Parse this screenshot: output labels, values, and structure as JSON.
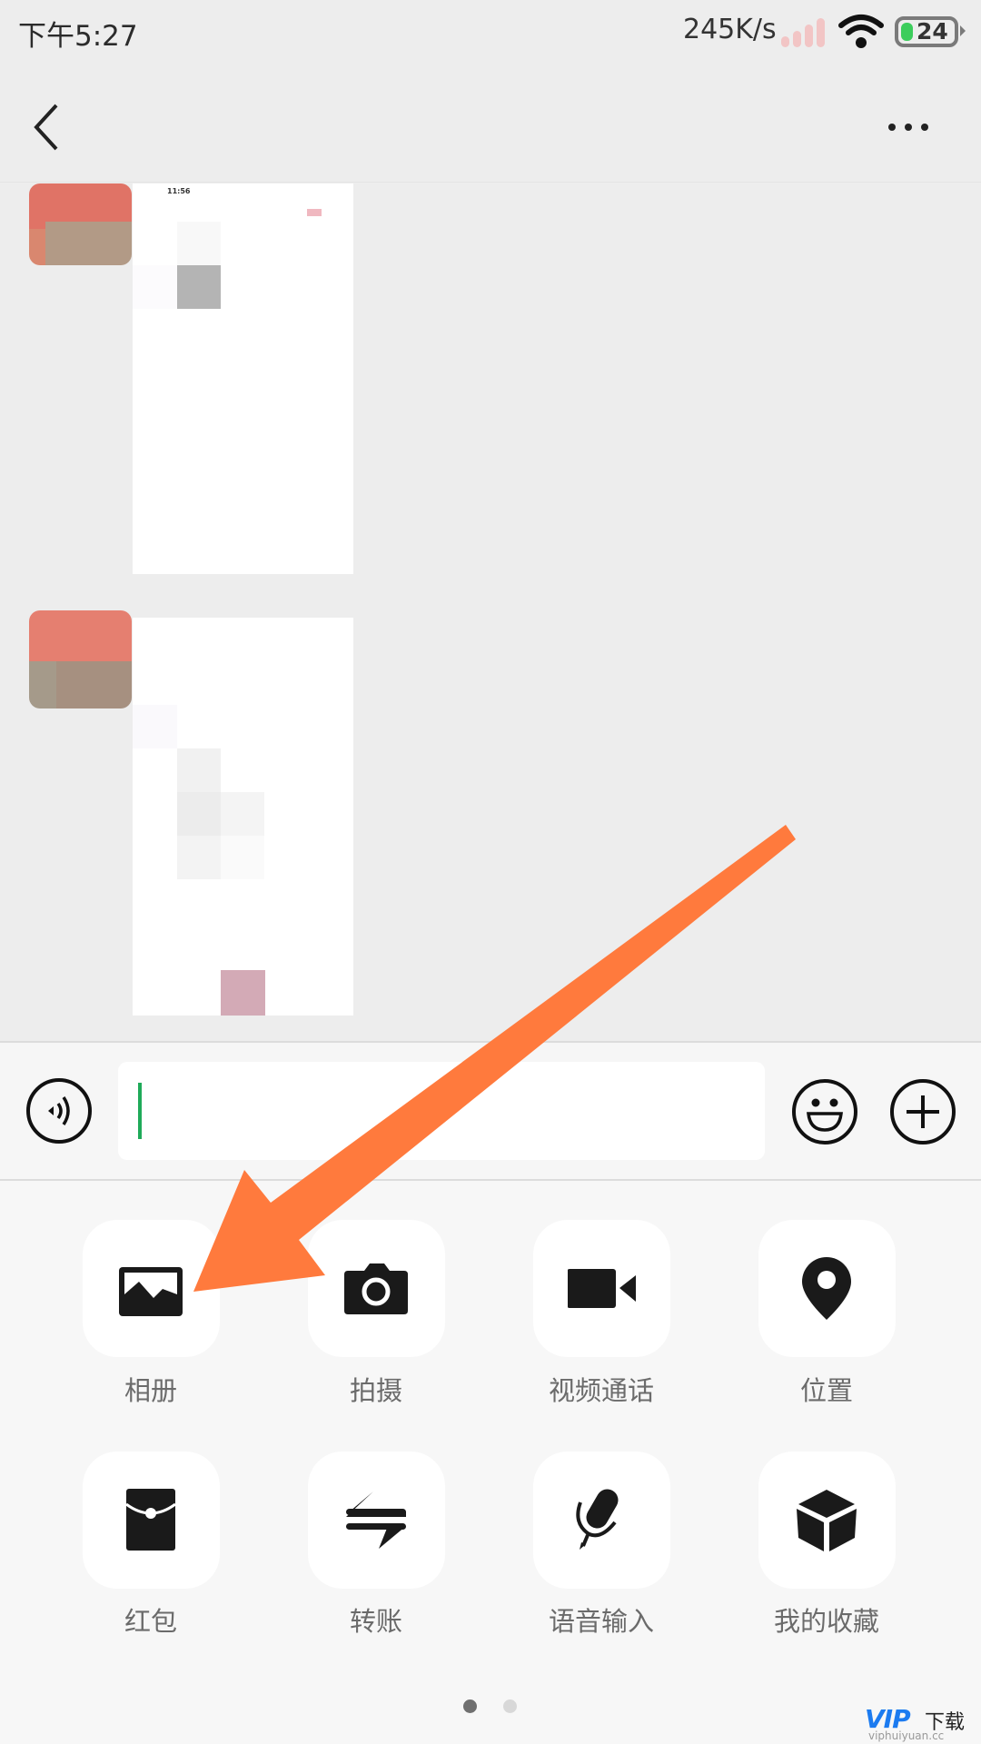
{
  "status_bar": {
    "time": "下午5:27",
    "network_speed": "245K/s",
    "battery_level": "24",
    "icons": [
      "signal-icon",
      "wifi-icon",
      "battery-icon"
    ]
  },
  "header": {
    "back_icon": "chevron-left-icon",
    "more_icon": "more-horizontal-icon"
  },
  "chat": {
    "messages": [
      {
        "type": "image",
        "sender": "contact",
        "inner_screenshot_time": "11:56"
      },
      {
        "type": "image",
        "sender": "contact"
      }
    ]
  },
  "input_bar": {
    "voice_icon": "voice-icon",
    "text_value": "",
    "emoji_icon": "emoji-icon",
    "plus_icon": "plus-icon"
  },
  "panel": {
    "items": [
      {
        "label": "相册",
        "icon": "photo-album-icon"
      },
      {
        "label": "拍摄",
        "icon": "camera-icon"
      },
      {
        "label": "视频通话",
        "icon": "video-call-icon"
      },
      {
        "label": "位置",
        "icon": "location-pin-icon"
      },
      {
        "label": "红包",
        "icon": "red-packet-icon"
      },
      {
        "label": "转账",
        "icon": "transfer-icon"
      },
      {
        "label": "语音输入",
        "icon": "microphone-icon"
      },
      {
        "label": "我的收藏",
        "icon": "favorites-cube-icon"
      }
    ],
    "pager": {
      "pages": 2,
      "current": 1
    }
  },
  "annotation": {
    "type": "arrow",
    "color": "#ff7a3d",
    "points_to": "相册"
  },
  "watermark": {
    "brand": "VIP",
    "text": "下载",
    "url": "viphuiyuan.cc"
  },
  "colors": {
    "accent_cursor": "#1faa59",
    "chat_bg": "#ededed",
    "panel_bg": "#f7f7f7"
  }
}
